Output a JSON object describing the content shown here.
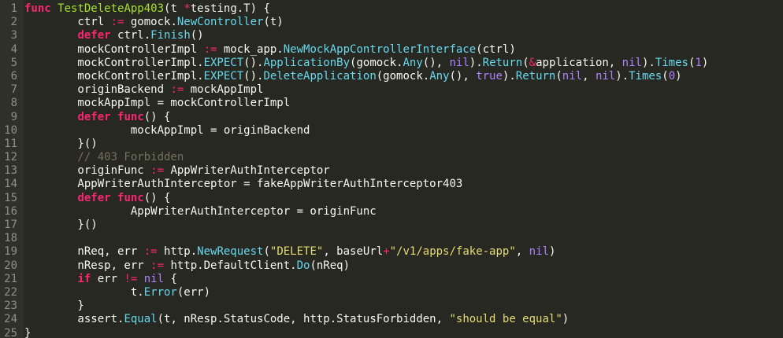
{
  "editor": {
    "theme_colors": {
      "background": "#272822",
      "keyword": "#f92672",
      "function": "#a6e22e",
      "call": "#66d9ef",
      "constant": "#ae81ff",
      "string": "#e6db74",
      "comment": "#75715e",
      "text": "#f8f8f2",
      "line_number": "#8f908a"
    },
    "lines": [
      {
        "n": "1",
        "tokens": [
          {
            "t": "kw",
            "v": "func"
          },
          {
            "t": "txt",
            "v": " "
          },
          {
            "t": "fn",
            "v": "TestDeleteApp403"
          },
          {
            "t": "txt",
            "v": "(t "
          },
          {
            "t": "op",
            "v": "*"
          },
          {
            "t": "txt",
            "v": "testing.T) {"
          }
        ]
      },
      {
        "n": "2",
        "tokens": [
          {
            "t": "txt",
            "v": "        ctrl "
          },
          {
            "t": "op",
            "v": ":="
          },
          {
            "t": "txt",
            "v": " gomock."
          },
          {
            "t": "call",
            "v": "NewController"
          },
          {
            "t": "txt",
            "v": "(t)"
          }
        ]
      },
      {
        "n": "3",
        "tokens": [
          {
            "t": "txt",
            "v": "        "
          },
          {
            "t": "kw",
            "v": "defer"
          },
          {
            "t": "txt",
            "v": " ctrl."
          },
          {
            "t": "call",
            "v": "Finish"
          },
          {
            "t": "txt",
            "v": "()"
          }
        ]
      },
      {
        "n": "4",
        "tokens": [
          {
            "t": "txt",
            "v": "        mockControllerImpl "
          },
          {
            "t": "op",
            "v": ":="
          },
          {
            "t": "txt",
            "v": " mock_app."
          },
          {
            "t": "call",
            "v": "NewMockAppControllerInterface"
          },
          {
            "t": "txt",
            "v": "(ctrl)"
          }
        ]
      },
      {
        "n": "5",
        "tokens": [
          {
            "t": "txt",
            "v": "        mockControllerImpl."
          },
          {
            "t": "call",
            "v": "EXPECT"
          },
          {
            "t": "txt",
            "v": "()."
          },
          {
            "t": "call",
            "v": "ApplicationBy"
          },
          {
            "t": "txt",
            "v": "(gomock."
          },
          {
            "t": "call",
            "v": "Any"
          },
          {
            "t": "txt",
            "v": "(), "
          },
          {
            "t": "const",
            "v": "nil"
          },
          {
            "t": "txt",
            "v": ")."
          },
          {
            "t": "call",
            "v": "Return"
          },
          {
            "t": "txt",
            "v": "("
          },
          {
            "t": "op",
            "v": "&"
          },
          {
            "t": "txt",
            "v": "application, "
          },
          {
            "t": "const",
            "v": "nil"
          },
          {
            "t": "txt",
            "v": ")."
          },
          {
            "t": "call",
            "v": "Times"
          },
          {
            "t": "txt",
            "v": "("
          },
          {
            "t": "const",
            "v": "1"
          },
          {
            "t": "txt",
            "v": ")"
          }
        ]
      },
      {
        "n": "6",
        "tokens": [
          {
            "t": "txt",
            "v": "        mockControllerImpl."
          },
          {
            "t": "call",
            "v": "EXPECT"
          },
          {
            "t": "txt",
            "v": "()."
          },
          {
            "t": "call",
            "v": "DeleteApplication"
          },
          {
            "t": "txt",
            "v": "(gomock."
          },
          {
            "t": "call",
            "v": "Any"
          },
          {
            "t": "txt",
            "v": "(), "
          },
          {
            "t": "const",
            "v": "true"
          },
          {
            "t": "txt",
            "v": ")."
          },
          {
            "t": "call",
            "v": "Return"
          },
          {
            "t": "txt",
            "v": "("
          },
          {
            "t": "const",
            "v": "nil"
          },
          {
            "t": "txt",
            "v": ", "
          },
          {
            "t": "const",
            "v": "nil"
          },
          {
            "t": "txt",
            "v": ")."
          },
          {
            "t": "call",
            "v": "Times"
          },
          {
            "t": "txt",
            "v": "("
          },
          {
            "t": "const",
            "v": "0"
          },
          {
            "t": "txt",
            "v": ")"
          }
        ]
      },
      {
        "n": "7",
        "tokens": [
          {
            "t": "txt",
            "v": "        originBackend "
          },
          {
            "t": "op",
            "v": ":="
          },
          {
            "t": "txt",
            "v": " mockAppImpl"
          }
        ]
      },
      {
        "n": "8",
        "tokens": [
          {
            "t": "txt",
            "v": "        mockAppImpl = mockControllerImpl"
          }
        ]
      },
      {
        "n": "9",
        "tokens": [
          {
            "t": "txt",
            "v": "        "
          },
          {
            "t": "kw",
            "v": "defer"
          },
          {
            "t": "txt",
            "v": " "
          },
          {
            "t": "kw",
            "v": "func"
          },
          {
            "t": "txt",
            "v": "() {"
          }
        ]
      },
      {
        "n": "10",
        "tokens": [
          {
            "t": "txt",
            "v": "                mockAppImpl = originBackend"
          }
        ]
      },
      {
        "n": "11",
        "tokens": [
          {
            "t": "txt",
            "v": "        }()"
          }
        ]
      },
      {
        "n": "12",
        "tokens": [
          {
            "t": "cm",
            "v": "        // 403 Forbidden"
          }
        ]
      },
      {
        "n": "13",
        "tokens": [
          {
            "t": "txt",
            "v": "        originFunc "
          },
          {
            "t": "op",
            "v": ":="
          },
          {
            "t": "txt",
            "v": " AppWriterAuthInterceptor"
          }
        ]
      },
      {
        "n": "14",
        "tokens": [
          {
            "t": "txt",
            "v": "        AppWriterAuthInterceptor = fakeAppWriterAuthInterceptor403"
          }
        ]
      },
      {
        "n": "15",
        "tokens": [
          {
            "t": "txt",
            "v": "        "
          },
          {
            "t": "kw",
            "v": "defer"
          },
          {
            "t": "txt",
            "v": " "
          },
          {
            "t": "kw",
            "v": "func"
          },
          {
            "t": "txt",
            "v": "() {"
          }
        ]
      },
      {
        "n": "16",
        "tokens": [
          {
            "t": "txt",
            "v": "                AppWriterAuthInterceptor = originFunc"
          }
        ]
      },
      {
        "n": "17",
        "tokens": [
          {
            "t": "txt",
            "v": "        }()"
          }
        ]
      },
      {
        "n": "18",
        "tokens": [
          {
            "t": "txt",
            "v": ""
          }
        ]
      },
      {
        "n": "19",
        "tokens": [
          {
            "t": "txt",
            "v": "        nReq, err "
          },
          {
            "t": "op",
            "v": ":="
          },
          {
            "t": "txt",
            "v": " http."
          },
          {
            "t": "call",
            "v": "NewRequest"
          },
          {
            "t": "txt",
            "v": "("
          },
          {
            "t": "str",
            "v": "\"DELETE\""
          },
          {
            "t": "txt",
            "v": ", baseUrl"
          },
          {
            "t": "op",
            "v": "+"
          },
          {
            "t": "str",
            "v": "\"/v1/apps/fake-app\""
          },
          {
            "t": "txt",
            "v": ", "
          },
          {
            "t": "const",
            "v": "nil"
          },
          {
            "t": "txt",
            "v": ")"
          }
        ]
      },
      {
        "n": "20",
        "tokens": [
          {
            "t": "txt",
            "v": "        nResp, err "
          },
          {
            "t": "op",
            "v": ":="
          },
          {
            "t": "txt",
            "v": " http.DefaultClient."
          },
          {
            "t": "call",
            "v": "Do"
          },
          {
            "t": "txt",
            "v": "(nReq)"
          }
        ]
      },
      {
        "n": "21",
        "tokens": [
          {
            "t": "txt",
            "v": "        "
          },
          {
            "t": "kw",
            "v": "if"
          },
          {
            "t": "txt",
            "v": " err "
          },
          {
            "t": "op",
            "v": "!="
          },
          {
            "t": "txt",
            "v": " "
          },
          {
            "t": "const",
            "v": "nil"
          },
          {
            "t": "txt",
            "v": " {"
          }
        ]
      },
      {
        "n": "22",
        "tokens": [
          {
            "t": "txt",
            "v": "                t."
          },
          {
            "t": "call",
            "v": "Error"
          },
          {
            "t": "txt",
            "v": "(err)"
          }
        ]
      },
      {
        "n": "23",
        "tokens": [
          {
            "t": "txt",
            "v": "        }"
          }
        ]
      },
      {
        "n": "24",
        "tokens": [
          {
            "t": "txt",
            "v": "        assert."
          },
          {
            "t": "call",
            "v": "Equal"
          },
          {
            "t": "txt",
            "v": "(t, nResp.StatusCode, http.StatusForbidden, "
          },
          {
            "t": "str",
            "v": "\"should be equal\""
          },
          {
            "t": "txt",
            "v": ")"
          }
        ]
      },
      {
        "n": "25",
        "tokens": [
          {
            "t": "txt",
            "v": "}"
          }
        ]
      }
    ]
  }
}
